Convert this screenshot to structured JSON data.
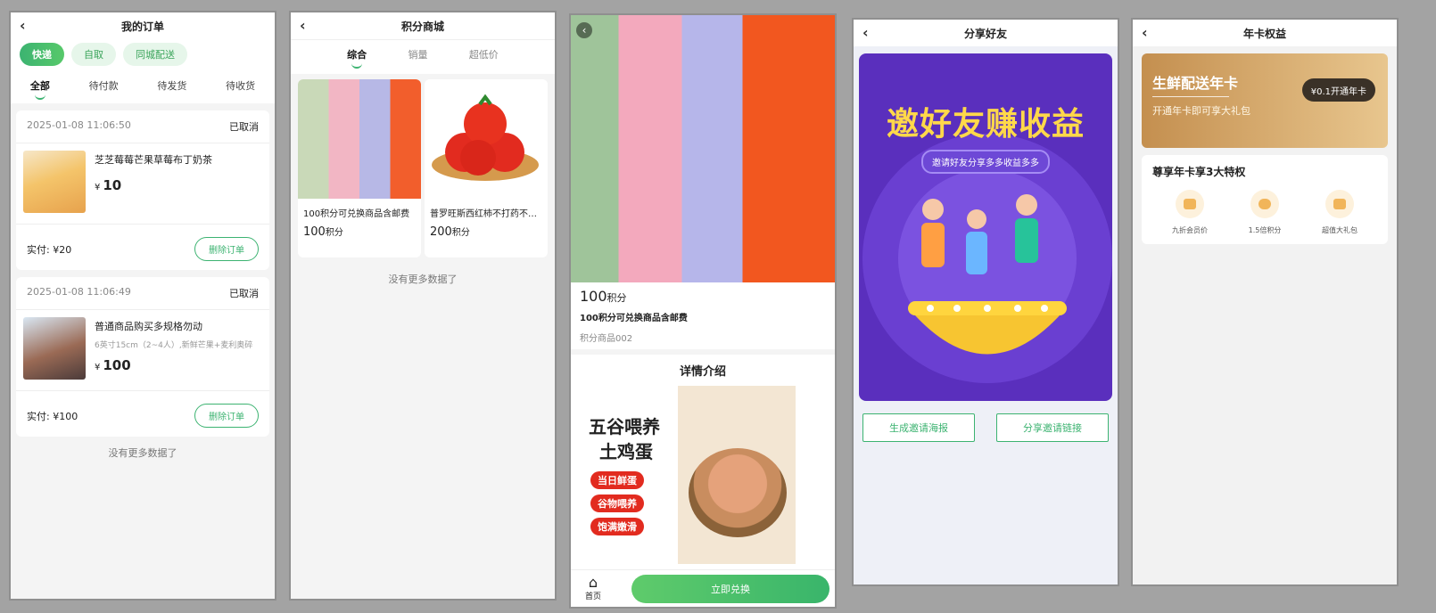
{
  "screen1": {
    "title": "我的订单",
    "chips": [
      "快递",
      "自取",
      "同城配送"
    ],
    "tabs": [
      "全部",
      "待付款",
      "待发货",
      "待收货"
    ],
    "orders": [
      {
        "time": "2025-01-08 11:06:50",
        "status": "已取消",
        "name": "芝芝莓莓芒果草莓布丁奶茶",
        "spec": "",
        "currency": "¥",
        "price": "10",
        "paid": "实付: ¥20",
        "action": "删除订单"
      },
      {
        "time": "2025-01-08 11:06:49",
        "status": "已取消",
        "name": "普通商品购买多规格勿动",
        "spec": "6英寸15cm（2~4人）,新鲜芒果+麦利奥碎",
        "currency": "¥",
        "price": "100",
        "paid": "实付: ¥100",
        "action": "删除订单"
      }
    ],
    "no_more": "没有更多数据了"
  },
  "screen2": {
    "title": "积分商城",
    "tabs": [
      "综合",
      "销量",
      "超低价"
    ],
    "items": [
      {
        "title": "100积分可兑换商品含邮费",
        "points": "100",
        "unit": "积分"
      },
      {
        "title": "普罗旺斯西红柿不打药不…",
        "points": "200",
        "unit": "积分"
      }
    ],
    "no_more": "没有更多数据了"
  },
  "screen3": {
    "points": "100",
    "unit": "积分",
    "name": "100积分可兑换商品含邮费",
    "code": "积分商品002",
    "detail_title": "详情介绍",
    "egg_lines": [
      "五谷喂养",
      "土鸡蛋",
      "当日鲜蛋",
      "谷物喂养",
      "饱满嫩滑"
    ],
    "home_label": "首页",
    "exchange_label": "立即兑换"
  },
  "screen4": {
    "title": "分享好友",
    "poster_title": "邀好友赚收益",
    "poster_sub": "邀请好友分享多多收益多多",
    "btn_poster": "生成邀请海报",
    "btn_link": "分享邀请链接"
  },
  "screen5": {
    "title": "年卡权益",
    "vip_title": "生鲜配送年卡",
    "vip_sub": "开通年卡即可享大礼包",
    "vip_btn": "¥0.1开通年卡",
    "perks_title": "尊享年卡享3大特权",
    "perks": [
      "九折会员价",
      "1.5倍积分",
      "超值大礼包"
    ]
  },
  "colors": {
    "primary": "#3cb371",
    "purple": "#5a2fbd",
    "gold": "#c48f4f"
  }
}
